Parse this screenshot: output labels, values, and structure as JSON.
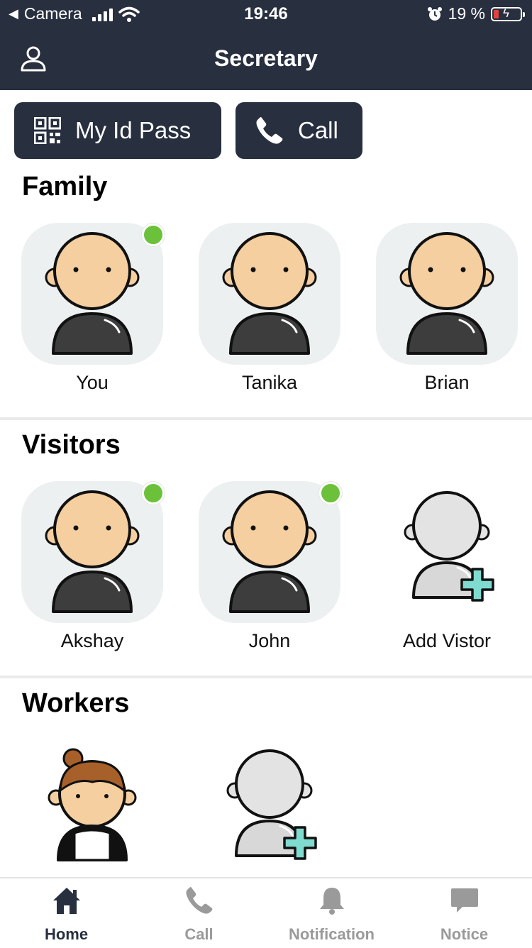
{
  "status_bar": {
    "back_app": "Camera",
    "time": "19:46",
    "battery_percent": "19 %"
  },
  "header": {
    "title": "Secretary"
  },
  "actions": {
    "id_pass_label": "My Id Pass",
    "call_label": "Call"
  },
  "family": {
    "title": "Family",
    "members": [
      {
        "name": "You",
        "online": true
      },
      {
        "name": "Tanika",
        "online": false
      },
      {
        "name": "Brian",
        "online": false
      }
    ]
  },
  "visitors": {
    "title": "Visitors",
    "members": [
      {
        "name": "Akshay",
        "online": true
      },
      {
        "name": "John",
        "online": true
      }
    ],
    "add_label": "Add Vistor"
  },
  "workers": {
    "title": "Workers"
  },
  "bottom_nav": {
    "items": [
      {
        "label": "Home",
        "icon": "home-icon",
        "active": true
      },
      {
        "label": "Call",
        "icon": "phone-icon",
        "active": false
      },
      {
        "label": "Notification",
        "icon": "bell-icon",
        "active": false
      },
      {
        "label": "Notice",
        "icon": "chat-icon",
        "active": false
      }
    ]
  },
  "colors": {
    "header_bg": "#282f3f",
    "online": "#6cc13b",
    "tile_bg": "#edf0f1",
    "add_plus": "#7fdad0"
  }
}
